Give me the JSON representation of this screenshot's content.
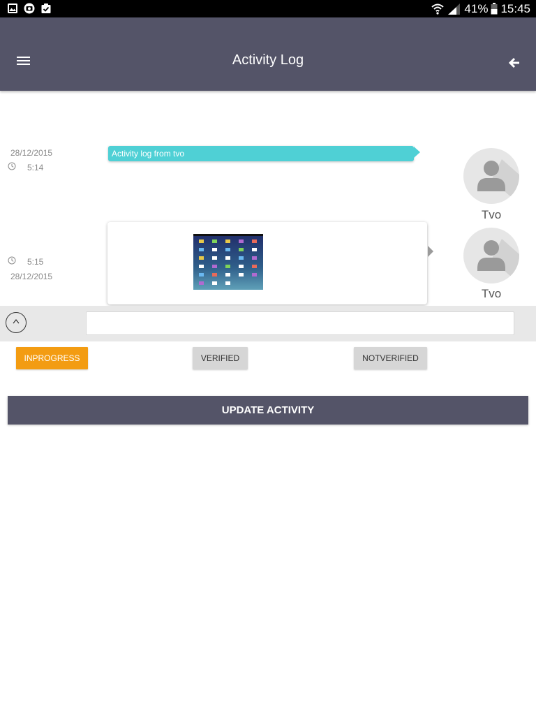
{
  "status_bar": {
    "battery": "41%",
    "time": "15:45",
    "icons": [
      "gallery-icon",
      "camera-icon",
      "clipboard-check-icon",
      "wifi-icon",
      "signal-icon",
      "battery-icon"
    ]
  },
  "header": {
    "title": "Activity Log",
    "menu_icon": "hamburger-menu-icon",
    "back_icon": "arrow-back-icon",
    "color": "#545468"
  },
  "activities": [
    {
      "date": "28/12/2015",
      "time": "5:14",
      "message": "Activity log from tvo",
      "author": "Tvo"
    },
    {
      "date": "28/12/2015",
      "time": "5:15",
      "attachment": "image-thumbnail",
      "author": "Tvo"
    }
  ],
  "composer": {
    "expand_icon": "chevron-up-circle-icon",
    "value": ""
  },
  "status_buttons": {
    "inprogress": "INPROGRESS",
    "verified": "VERIFIED",
    "notverified": "NOTVERIFIED"
  },
  "actions": {
    "update_label": "UPDATE ACTIVITY"
  },
  "colors": {
    "accent": "#4fd0d5",
    "active_status": "#f39c12",
    "inactive_status": "#d6d6d6"
  }
}
